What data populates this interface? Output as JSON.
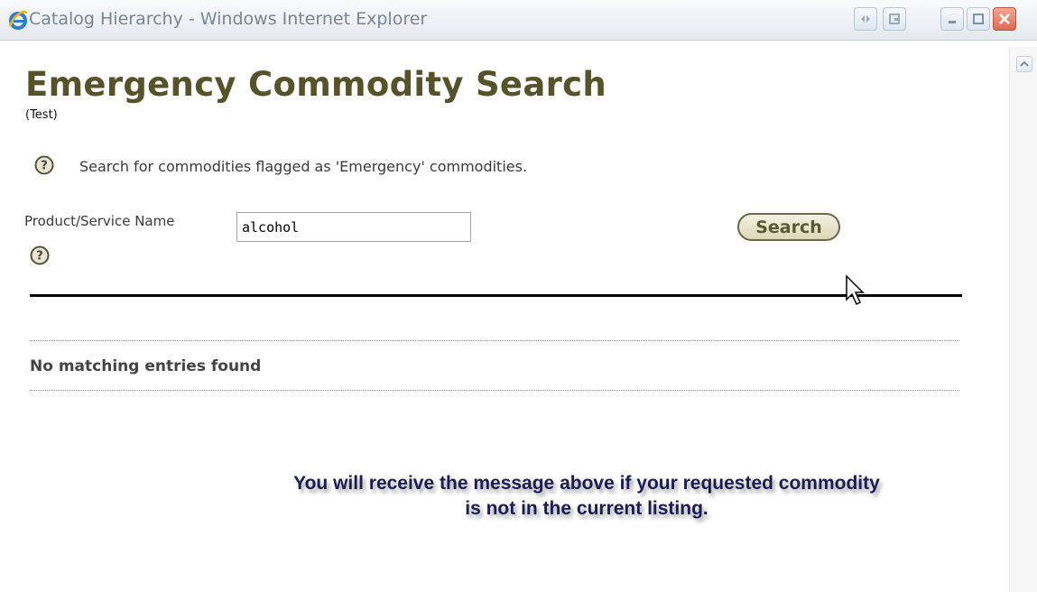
{
  "window": {
    "title": "Catalog Hierarchy - Windows Internet Explorer"
  },
  "page": {
    "title": "Emergency Commodity Search",
    "subtitle": "(Test)",
    "description": "Search for commodities flagged as 'Emergency' commodities."
  },
  "search": {
    "field_label": "Product/Service Name",
    "value": "alcohol",
    "button_label": "Search"
  },
  "results": {
    "message": "No matching entries found"
  },
  "annotation": {
    "line1": "You will receive the message above if your requested commodity",
    "line2": "is not in the current listing."
  },
  "icons": {
    "browser": "internet-explorer-icon",
    "help": "question-mark-circle-icon",
    "cursor": "mouse-pointer-icon"
  },
  "colors": {
    "title": "#56532b",
    "button_border": "#6b6a4a",
    "annotation": "#1c1c52"
  }
}
